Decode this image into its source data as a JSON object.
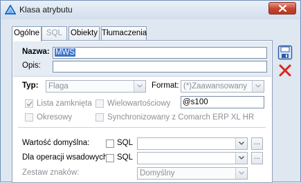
{
  "window": {
    "title": "Klasa atrybutu"
  },
  "tabs": [
    {
      "label": "Ogólne",
      "state": "active"
    },
    {
      "label": "SQL",
      "state": "disabled"
    },
    {
      "label": "Obiekty",
      "state": "normal"
    },
    {
      "label": "Tłumaczenia",
      "state": "normal"
    }
  ],
  "form": {
    "nazwa_label": "Nazwa:",
    "nazwa_value": "MWS",
    "opis_label": "Opis:",
    "opis_value": "",
    "typ_label": "Typ:",
    "typ_value": "Flaga",
    "format_label": "Format:",
    "format_value": "(*)Zaawansowany",
    "lista_zamknieta_label": "Lista zamknięta",
    "wielowartosciowy_label": "Wielowartościowy",
    "format_field_value": "@s100",
    "okresowy_label": "Okresowy",
    "synchronizowany_label": "Synchronizowany z Comarch ERP XL HR",
    "wartosc_domyslna_label": "Wartość domyślna:",
    "sql_label_1": "SQL",
    "dla_operacji_label": "Dla operacji wsadowych:",
    "sql_label_2": "SQL",
    "zestaw_znakow_label": "Zestaw znaków:",
    "zestaw_znakow_value": "Domyślny",
    "ellipsis": "..."
  },
  "icons": {
    "app": "triangle-logo-icon",
    "close": "close-icon",
    "save": "save-icon",
    "cancel": "cancel-icon"
  },
  "colors": {
    "accent": "#3b72c9",
    "close_button": "#c7432c",
    "cancel_red": "#d8261b",
    "save_blue": "#2c5aa8"
  }
}
